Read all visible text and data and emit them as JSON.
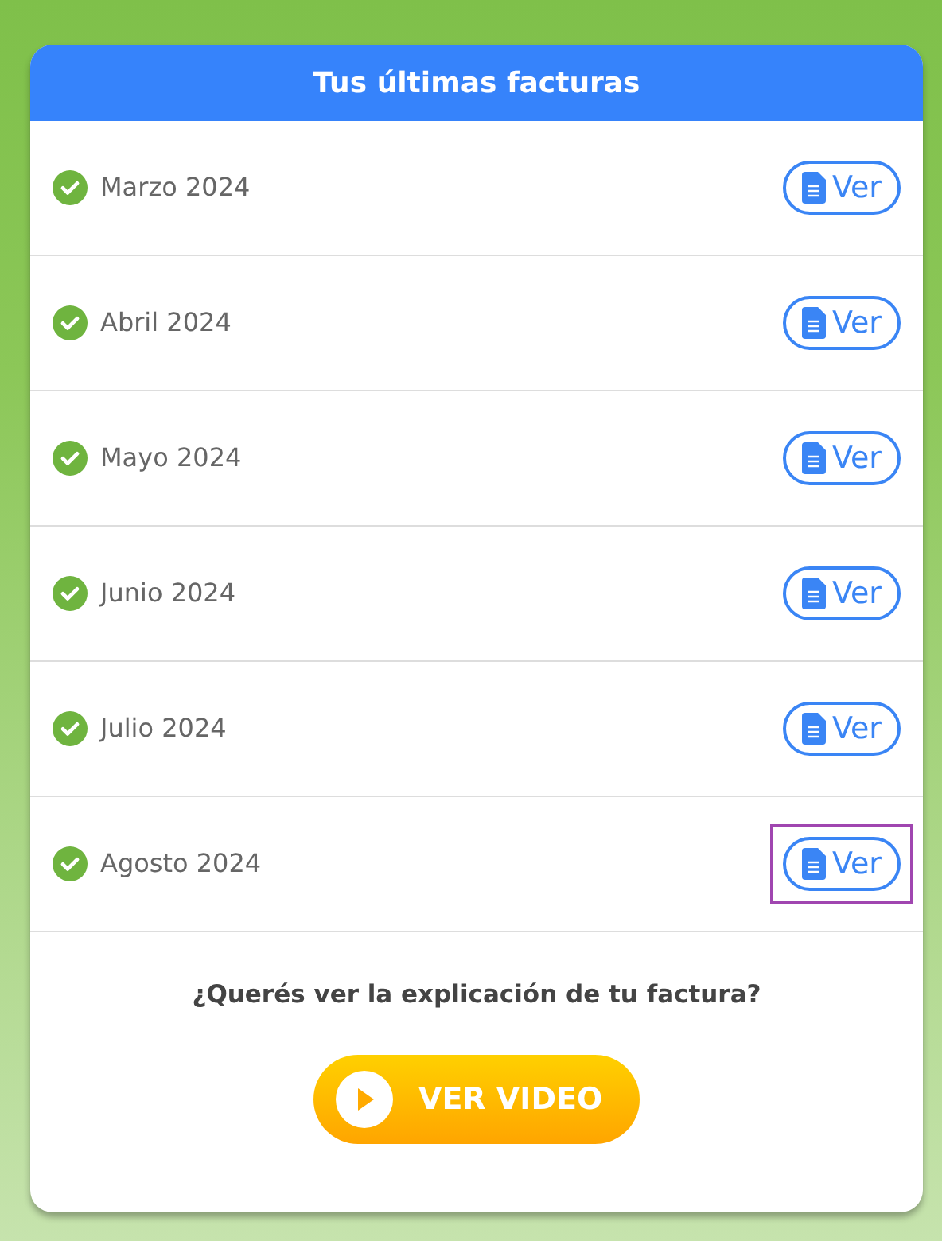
{
  "card": {
    "title": "Tus últimas facturas"
  },
  "invoices": [
    {
      "period": "Marzo 2024",
      "paid": true,
      "action": "Ver",
      "highlighted": false
    },
    {
      "period": "Abril 2024",
      "paid": true,
      "action": "Ver",
      "highlighted": false
    },
    {
      "period": "Mayo 2024",
      "paid": true,
      "action": "Ver",
      "highlighted": false
    },
    {
      "period": "Junio 2024",
      "paid": true,
      "action": "Ver",
      "highlighted": false
    },
    {
      "period": "Julio 2024",
      "paid": true,
      "action": "Ver",
      "highlighted": false
    },
    {
      "period": "Agosto 2024",
      "paid": true,
      "action": "Ver",
      "highlighted": true
    }
  ],
  "video": {
    "question": "¿Querés ver la explicación de tu factura?",
    "button": "VER VIDEO"
  }
}
